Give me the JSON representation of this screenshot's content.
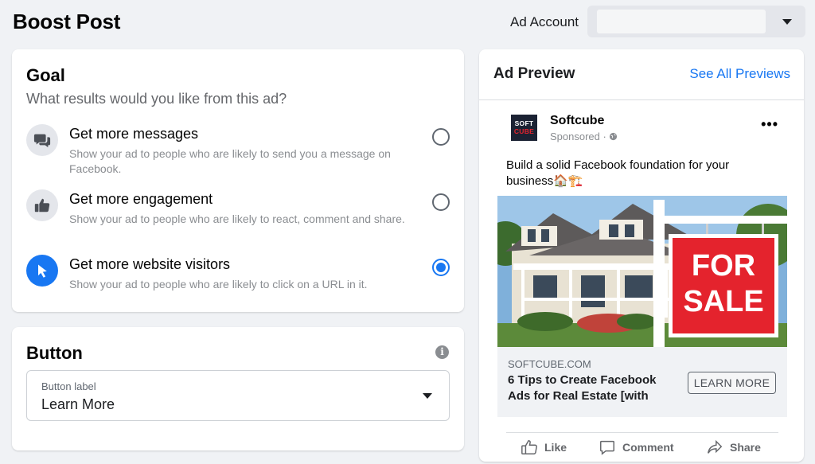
{
  "header": {
    "title": "Boost Post",
    "ad_account_label": "Ad Account",
    "ad_account_value": ""
  },
  "goal": {
    "heading": "Goal",
    "subtitle": "What results would you like from this ad?",
    "options": [
      {
        "title": "Get more messages",
        "description": "Show your ad to people who are likely to send you a message on Facebook.",
        "icon": "chat-icon",
        "selected": false
      },
      {
        "title": "Get more engagement",
        "description": "Show your ad to people who are likely to react, comment and share.",
        "icon": "thumbs-up-icon",
        "selected": false
      },
      {
        "title": "Get more website visitors",
        "description": "Show your ad to people who are likely to click on a URL in it.",
        "icon": "cursor-icon",
        "selected": true
      }
    ]
  },
  "button_section": {
    "heading": "Button",
    "field_label": "Button label",
    "field_value": "Learn More"
  },
  "preview": {
    "heading": "Ad Preview",
    "see_all": "See All Previews",
    "page_name": "Softcube",
    "sponsored": "Sponsored · ",
    "logo_top": "SOFT",
    "logo_bottom": "CUBE",
    "post_text": "Build a solid Facebook foundation for your business🏠🏗️",
    "image_sign_line1": "FOR",
    "image_sign_line2": "SALE",
    "link_domain": "SOFTCUBE.COM",
    "link_title": "6 Tips to Create Facebook Ads for Real Estate [with",
    "cta": "LEARN MORE",
    "actions": {
      "like": "Like",
      "comment": "Comment",
      "share": "Share"
    }
  },
  "colors": {
    "accent": "#1877f2",
    "background": "#f0f2f5",
    "sign_red": "#e4232d"
  }
}
